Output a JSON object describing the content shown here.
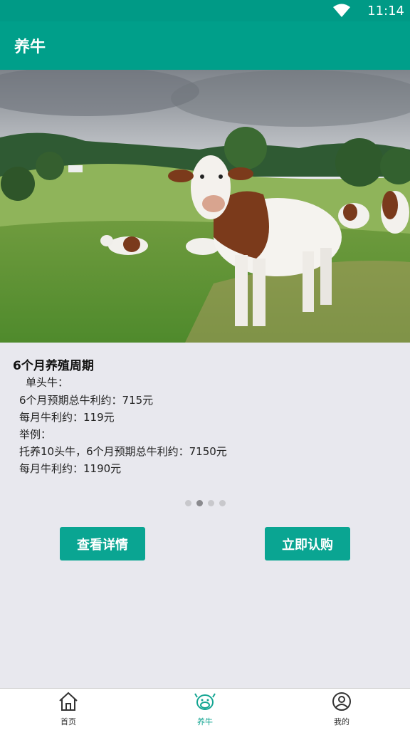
{
  "status_bar": {
    "time": "11:14"
  },
  "app_bar": {
    "title": "养牛"
  },
  "hero": {
    "alt": "cows grazing"
  },
  "content": {
    "heading": "6个月养殖周期",
    "lines": [
      "单头牛：",
      "6个月预期总牛利约：715元",
      "每月牛利约：119元",
      "举例：",
      "托养10头牛，6个月预期总牛利约：7150元",
      "每月牛利约：1190元"
    ],
    "carousel": {
      "total": 4,
      "active": 2
    }
  },
  "buttons": {
    "details": "查看详情",
    "subscribe": "立即认购"
  },
  "tabbar": {
    "items": [
      {
        "label": "首页",
        "icon": "home-icon"
      },
      {
        "label": "养牛",
        "icon": "cow-icon"
      },
      {
        "label": "我的",
        "icon": "user-icon"
      }
    ],
    "active": 1
  },
  "colors": {
    "primary": "#009f8a",
    "button": "#0aa592",
    "background": "#e8e8ee"
  }
}
